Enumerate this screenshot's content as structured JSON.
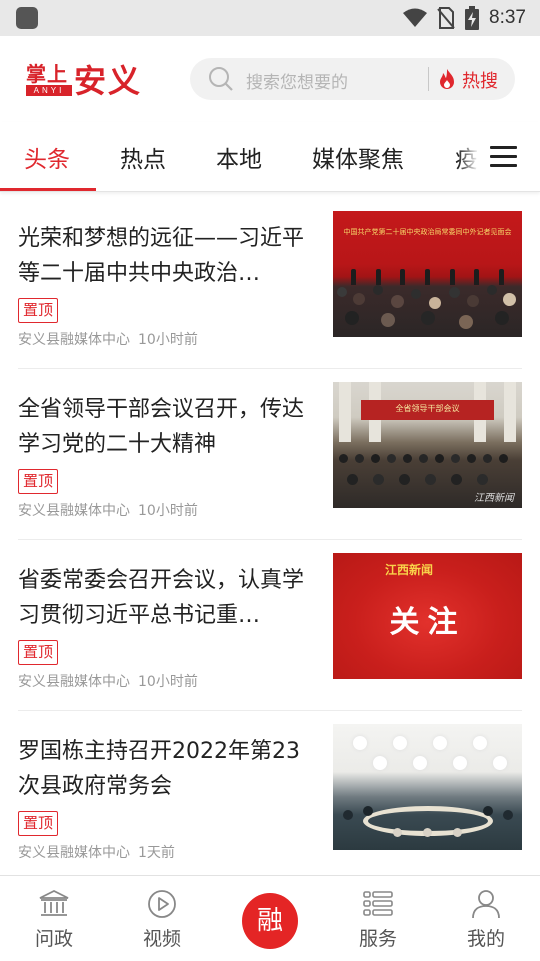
{
  "status_bar": {
    "time": "8:37",
    "icons": [
      "app-notification-icon",
      "wifi-icon",
      "no-sim-icon",
      "battery-charging-icon"
    ]
  },
  "header": {
    "logo_small": "掌上",
    "logo_pinyin": "ANYI",
    "logo_big": "安义",
    "search_placeholder": "搜索您想要的",
    "hot_label": "热搜",
    "colors": {
      "accent": "#e0282e",
      "search_bg": "#f1f1f1"
    }
  },
  "tabs": {
    "items": [
      "头条",
      "热点",
      "本地",
      "媒体聚焦",
      "疫"
    ],
    "active_index": 0
  },
  "feed": {
    "items": [
      {
        "title": "光荣和梦想的远征——习近平等二十届中共中央政治…",
        "tag": "置顶",
        "source": "安义县融媒体中心",
        "time": "10小时前",
        "thumb_caption": "中国共产党第二十届中央政治局常委同中外记者见面会"
      },
      {
        "title": "全省领导干部会议召开，传达学习党的二十大精神",
        "tag": "置顶",
        "source": "安义县融媒体中心",
        "time": "10小时前",
        "thumb_caption": "全省领导干部会议",
        "thumb_watermark": "江西新闻"
      },
      {
        "title": "省委常委会召开会议，认真学习贯彻习近平总书记重…",
        "tag": "置顶",
        "source": "安义县融媒体中心",
        "time": "10小时前",
        "thumb_caption": "关注",
        "thumb_logo": "江西新闻"
      },
      {
        "title": "罗国栋主持召开2022年第23次县政府常务会",
        "tag": "置顶",
        "source": "安义县融媒体中心",
        "time": "1天前"
      }
    ]
  },
  "bottom_nav": {
    "items": [
      {
        "label": "问政",
        "icon": "government-building-icon"
      },
      {
        "label": "视频",
        "icon": "play-circle-icon"
      },
      {
        "label": "融",
        "icon": "center-fusion-button"
      },
      {
        "label": "服务",
        "icon": "service-list-icon"
      },
      {
        "label": "我的",
        "icon": "user-profile-icon"
      }
    ]
  }
}
